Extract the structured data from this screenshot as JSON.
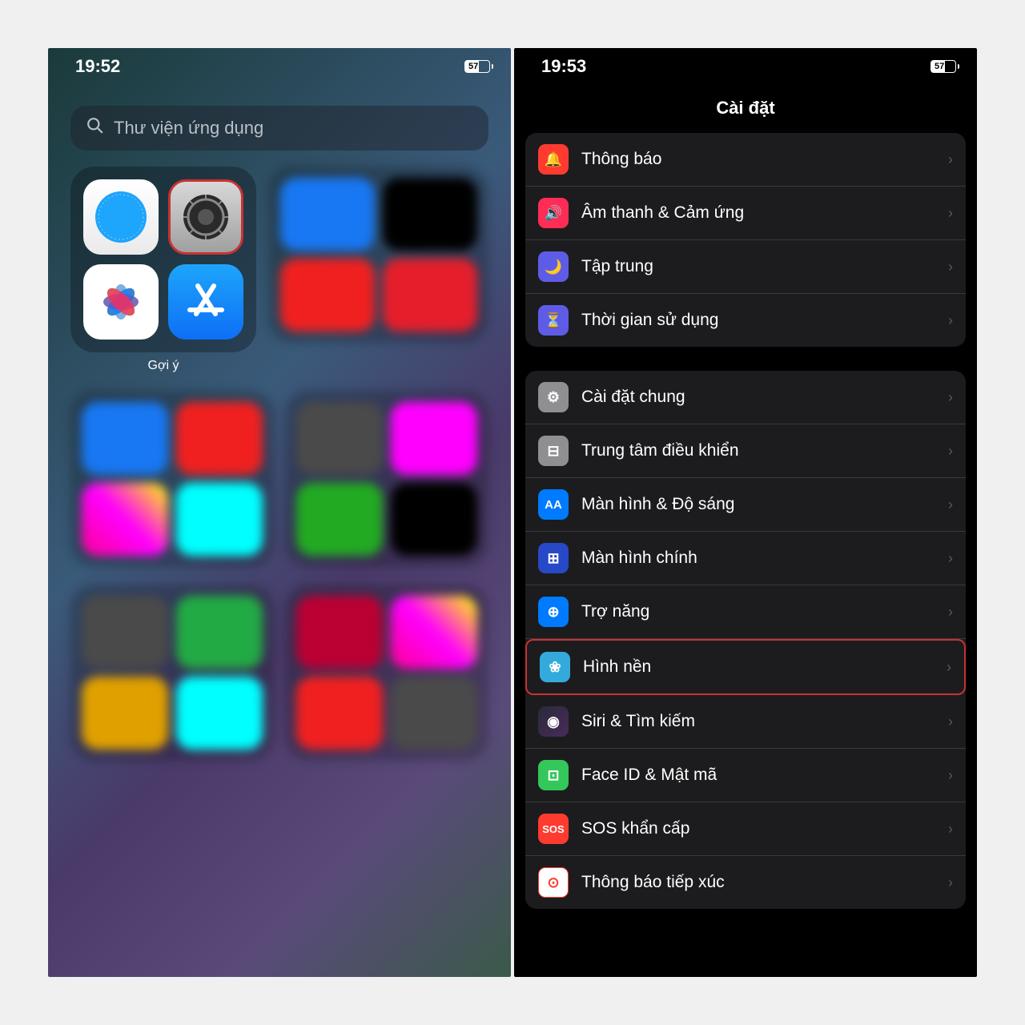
{
  "left": {
    "time": "19:52",
    "battery": "57",
    "search_placeholder": "Thư viện ứng dụng",
    "folder_label": "Gợi ý",
    "apps": [
      "Safari",
      "Cài đặt",
      "Ảnh",
      "App Store"
    ]
  },
  "right": {
    "time": "19:53",
    "battery": "57",
    "title": "Cài đặt",
    "group1": [
      {
        "label": "Thông báo",
        "icon": "notif",
        "name": "settings-notifications"
      },
      {
        "label": "Âm thanh & Cảm ứng",
        "icon": "sound",
        "name": "settings-sound-haptics"
      },
      {
        "label": "Tập trung",
        "icon": "focus",
        "name": "settings-focus"
      },
      {
        "label": "Thời gian sử dụng",
        "icon": "time",
        "name": "settings-screen-time"
      }
    ],
    "group2": [
      {
        "label": "Cài đặt chung",
        "icon": "general",
        "name": "settings-general"
      },
      {
        "label": "Trung tâm điều khiển",
        "icon": "control",
        "name": "settings-control-center"
      },
      {
        "label": "Màn hình & Độ sáng",
        "icon": "display",
        "name": "settings-display-brightness"
      },
      {
        "label": "Màn hình chính",
        "icon": "home",
        "name": "settings-home-screen"
      },
      {
        "label": "Trợ năng",
        "icon": "access",
        "name": "settings-accessibility"
      },
      {
        "label": "Hình nền",
        "icon": "wallpaper",
        "name": "settings-wallpaper",
        "highlight": true
      },
      {
        "label": "Siri & Tìm kiếm",
        "icon": "siri",
        "name": "settings-siri-search"
      },
      {
        "label": "Face ID & Mật mã",
        "icon": "faceid",
        "name": "settings-faceid-passcode"
      },
      {
        "label": "SOS khẩn cấp",
        "icon": "sos",
        "name": "settings-emergency-sos"
      },
      {
        "label": "Thông báo tiếp xúc",
        "icon": "exposure",
        "name": "settings-exposure-notification"
      }
    ]
  },
  "icons_glyph": {
    "notif": "🔔",
    "sound": "🔊",
    "focus": "🌙",
    "time": "⏳",
    "general": "⚙",
    "control": "⊟",
    "display": "AA",
    "home": "⊞",
    "access": "⊕",
    "wallpaper": "❀",
    "siri": "◉",
    "faceid": "⊡",
    "sos": "SOS",
    "exposure": "⊙"
  }
}
